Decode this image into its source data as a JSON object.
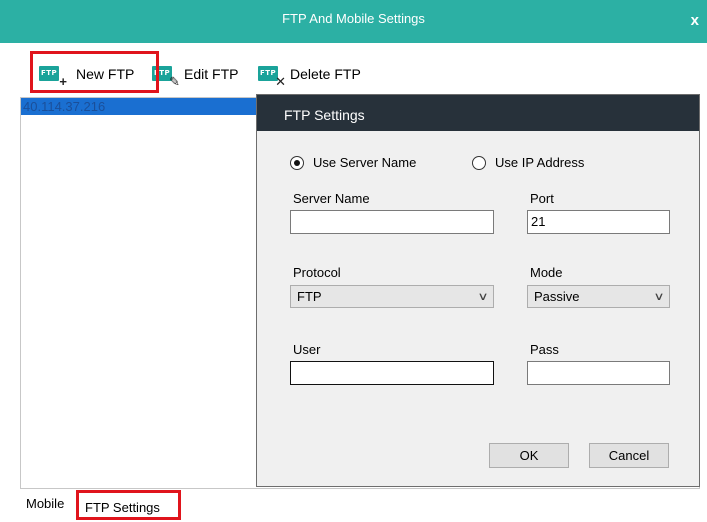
{
  "window": {
    "title": "FTP And Mobile Settings",
    "close_glyph": "x",
    "accent_color": "#2cb0a4"
  },
  "toolbar": {
    "new_label": "New FTP",
    "edit_label": "Edit FTP",
    "delete_label": "Delete FTP",
    "icon_text": "FTP",
    "icons": [
      "ftp-new-icon",
      "ftp-edit-icon",
      "ftp-delete-icon"
    ]
  },
  "ftp_list": {
    "items": [
      "40.114.37.216"
    ]
  },
  "ftp_settings": {
    "title": "FTP Settings",
    "use_server_name_label": "Use Server Name",
    "use_ip_address_label": "Use IP Address",
    "selected_mode": "Use Server Name",
    "server_name_label": "Server Name",
    "server_name_value": "",
    "port_label": "Port",
    "port_value": "21",
    "protocol_label": "Protocol",
    "protocol_value": "FTP",
    "mode_label": "Mode",
    "mode_value": "Passive",
    "user_label": "User",
    "user_value": "",
    "pass_label": "Pass",
    "pass_value": "",
    "ok_label": "OK",
    "cancel_label": "Cancel"
  },
  "tabs": {
    "mobile": "Mobile",
    "ftp_settings": "FTP Settings"
  },
  "highlight_color": "#e0141c"
}
